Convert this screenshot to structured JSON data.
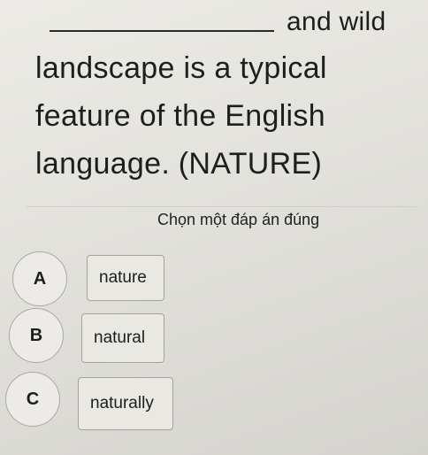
{
  "question": {
    "line1": "and wild",
    "line2": "landscape is a typical",
    "line3": "feature of the English",
    "line4": "language. (NATURE)"
  },
  "instruction": "Chọn một đáp án đúng",
  "options": [
    {
      "letter": "A",
      "text": "nature"
    },
    {
      "letter": "B",
      "text": "natural"
    },
    {
      "letter": "C",
      "text": "naturally"
    }
  ]
}
